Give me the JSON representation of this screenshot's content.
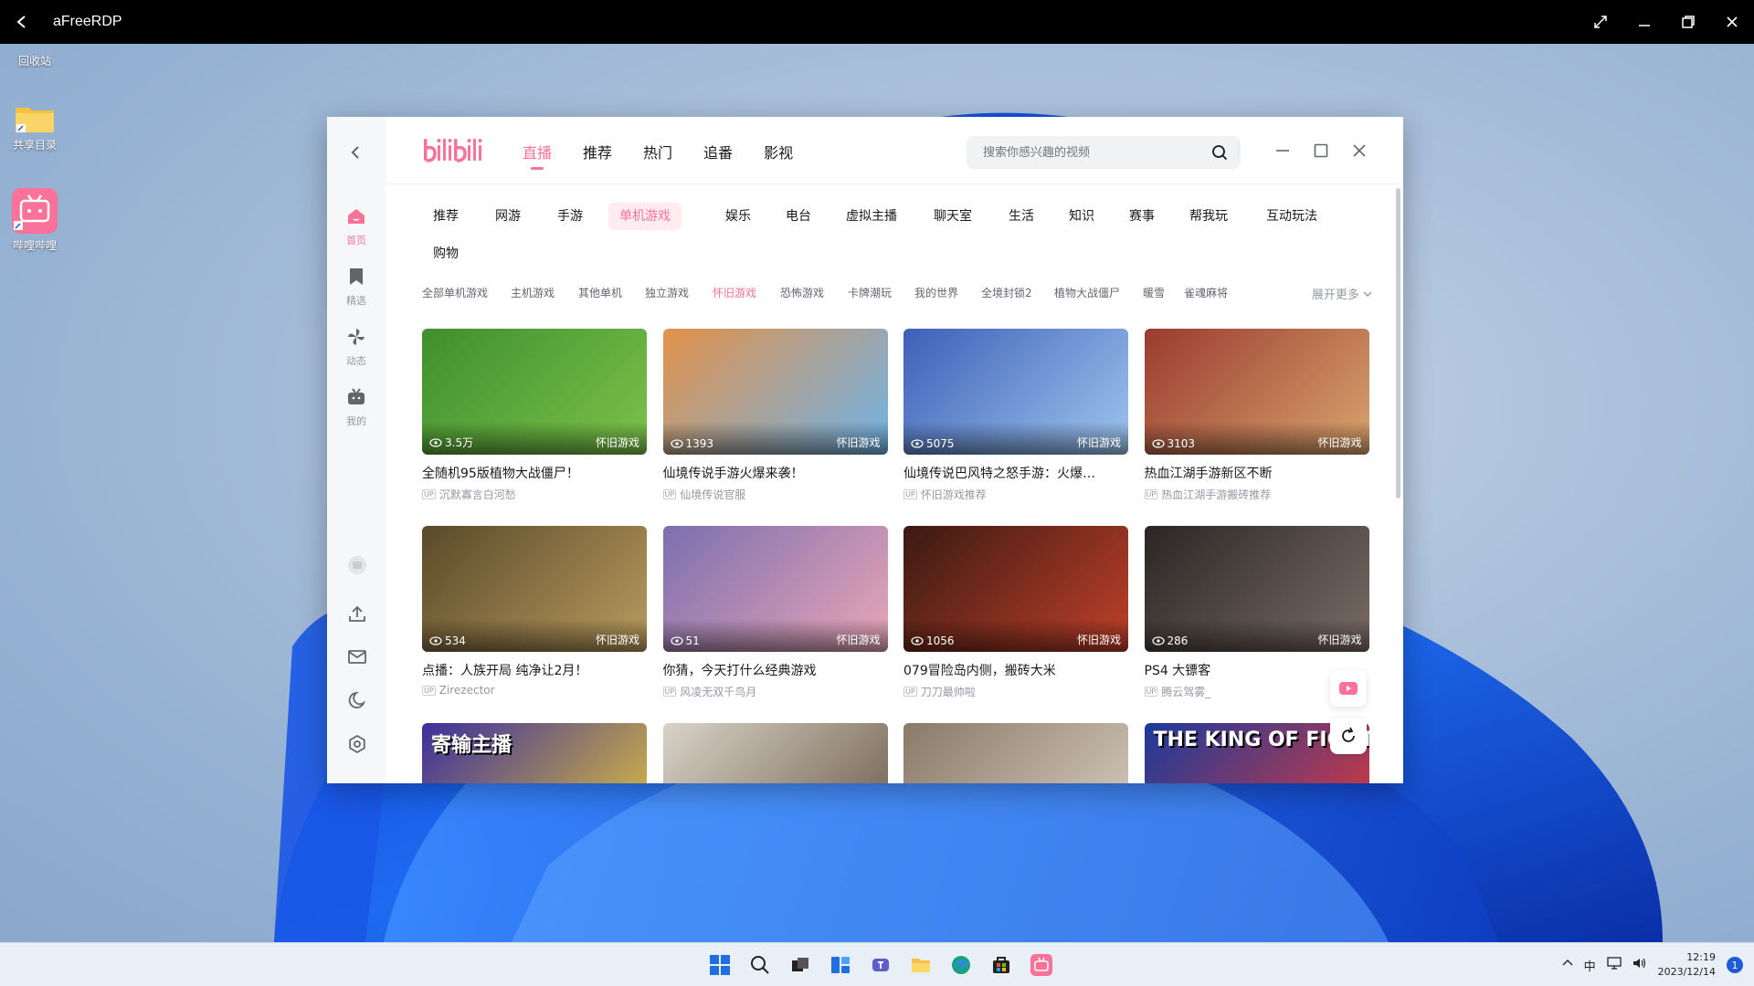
{
  "rdp": {
    "title": "aFreeRDP"
  },
  "desktop": {
    "icons": [
      {
        "label": "回收站"
      },
      {
        "label": "共享目录"
      },
      {
        "label": "哔哩哔哩"
      }
    ]
  },
  "app": {
    "logo_text": "bilibili",
    "nav": [
      "直播",
      "推荐",
      "热门",
      "追番",
      "影视"
    ],
    "nav_active": "直播",
    "search_placeholder": "搜索你感兴趣的视频",
    "sidebar": [
      {
        "label": "首页",
        "icon": "home-icon"
      },
      {
        "label": "精选",
        "icon": "bookmark-icon"
      },
      {
        "label": "动态",
        "icon": "pinwheel-icon"
      },
      {
        "label": "我的",
        "icon": "tv-icon"
      }
    ],
    "categories": [
      "推荐",
      "网游",
      "手游",
      "单机游戏",
      "娱乐",
      "电台",
      "虚拟主播",
      "聊天室",
      "生活",
      "知识",
      "赛事",
      "帮我玩",
      "互动玩法",
      "购物"
    ],
    "category_active": "单机游戏",
    "subcategories": [
      "全部单机游戏",
      "主机游戏",
      "其他单机",
      "独立游戏",
      "怀旧游戏",
      "恐怖游戏",
      "卡牌潮玩",
      "我的世界",
      "全境封锁2",
      "植物大战僵尸",
      "暖雪",
      "雀魂麻将"
    ],
    "subcategory_active": "怀旧游戏",
    "expand_label": "展开更多",
    "cards": [
      {
        "title": "全随机95版植物大战僵尸！",
        "owner": "沉默寡言白河愁",
        "views": "3.5万",
        "tag": "怀旧游戏",
        "colors": [
          "#3f8f2e",
          "#7cc24a"
        ]
      },
      {
        "title": "仙境传说手游火爆来袭！",
        "owner": "仙境传说官服",
        "views": "1393",
        "tag": "怀旧游戏",
        "colors": [
          "#e2924a",
          "#6fb3e8"
        ]
      },
      {
        "title": "仙境传说巴风特之怒手游：火爆…",
        "owner": "怀旧游戏推荐",
        "views": "5075",
        "tag": "怀旧游戏",
        "colors": [
          "#3e5fb8",
          "#9fc6ee"
        ]
      },
      {
        "title": "热血江湖手游新区不断",
        "owner": "热血江湖手游搬砖推荐",
        "views": "3103",
        "tag": "怀旧游戏",
        "colors": [
          "#9a3b2f",
          "#d9a46e"
        ]
      },
      {
        "title": "点播：人族开局 纯净让2月！",
        "owner": "Zirezector",
        "views": "534",
        "tag": "怀旧游戏",
        "colors": [
          "#5a4a2a",
          "#b99b5e"
        ]
      },
      {
        "title": "你猜，今天打什么经典游戏",
        "owner": "风凌无双千鸟月",
        "views": "51",
        "tag": "怀旧游戏",
        "colors": [
          "#7c6fb0",
          "#e9a6b6"
        ]
      },
      {
        "title": "079冒险岛内侧，搬砖大米",
        "owner": "刀刀最帅啦",
        "views": "1056",
        "tag": "怀旧游戏",
        "colors": [
          "#3a1a12",
          "#c0402a"
        ]
      },
      {
        "title": "PS4 大镖客",
        "owner": "腾云驾雾_",
        "views": "286",
        "tag": "怀旧游戏",
        "colors": [
          "#2a2625",
          "#7a6c66"
        ]
      },
      {
        "title": "寄输主播",
        "owner": "",
        "views": "",
        "tag": "",
        "colors": [
          "#3b2f9c",
          "#e6c43a"
        ]
      },
      {
        "title": "",
        "owner": "",
        "views": "",
        "tag": "",
        "colors": [
          "#d9d3c8",
          "#6b5a48"
        ]
      },
      {
        "title": "",
        "owner": "",
        "views": "",
        "tag": "",
        "colors": [
          "#8a7a68",
          "#d9cfc0"
        ]
      },
      {
        "title": "THE KING OF FIGHTERS",
        "owner": "",
        "views": "",
        "tag": "",
        "colors": [
          "#1a3a9a",
          "#e23a3a"
        ]
      }
    ]
  },
  "taskbar": {
    "ime": "中",
    "time": "12:19",
    "date": "2023/12/14",
    "notifications": "1"
  },
  "colors": {
    "accent": "#fb7299",
    "accent_bg": "#ffecf1"
  }
}
